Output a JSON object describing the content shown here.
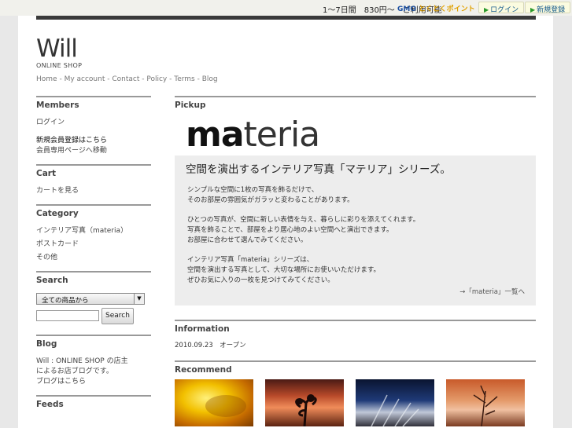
{
  "topbar": {
    "promo": "1〜7日間　830円〜　ご利用可能",
    "gmo_brand": "GMO",
    "gmo_points": "とくとくポイント",
    "login_label": "ログイン",
    "register_label": "新規登録"
  },
  "header": {
    "logo": "Will",
    "logo_sub": "ONLINE SHOP",
    "nav": [
      "Home",
      "My account",
      "Contact",
      "Policy",
      "Terms",
      "Blog"
    ],
    "nav_sep": " - "
  },
  "sidebar": {
    "members": {
      "title": "Members",
      "items": [
        "ログイン",
        "新規会員登録はこちら",
        "会員専用ページへ移動"
      ]
    },
    "cart": {
      "title": "Cart",
      "items": [
        "カートを見る"
      ]
    },
    "category": {
      "title": "Category",
      "items": [
        "インテリア写真（materia）",
        "ポストカード",
        "その他"
      ]
    },
    "search": {
      "title": "Search",
      "select_value": "全ての商品から",
      "input_value": "",
      "button_label": "Search"
    },
    "blog": {
      "title": "Blog",
      "items": [
        "Will : ONLINE SHOP の店主",
        "によるお店ブログです。",
        "ブログはこちら"
      ]
    },
    "feeds": {
      "title": "Feeds"
    }
  },
  "main": {
    "pickup": {
      "title": "Pickup",
      "banner_logo_bold": "ma",
      "banner_logo_rest": "teria",
      "banner_sub": "空間を演出するインテリア写真「マテリア」シリーズ。",
      "lines": [
        "シンプルな空間に1枚の写真を飾るだけで、",
        "そのお部屋の雰囲気がガラッと変わることがあります。",
        "",
        "ひとつの写真が、空間に新しい表情を与え、暮らしに彩りを添えてくれます。",
        "写真を飾ることで、部屋をより居心地のよい空間へと演出できます。",
        "お部屋に合わせて選んでみてください。",
        "",
        "インテリア写真「materia」シリーズは、",
        "空間を演出する写真として、大切な場所にお使いいただけます。",
        "ぜひお気に入りの一枚を見つけてみてください。"
      ],
      "link": "→「materia」一覧へ"
    },
    "information": {
      "title": "Information",
      "line": "2010.09.23　オープン"
    },
    "recommend": {
      "title": "Recommend",
      "thumbs": [
        "yellow-flower-photo",
        "sunset-silhouette-photo",
        "night-sky-photo",
        "dusk-branches-photo"
      ]
    }
  }
}
